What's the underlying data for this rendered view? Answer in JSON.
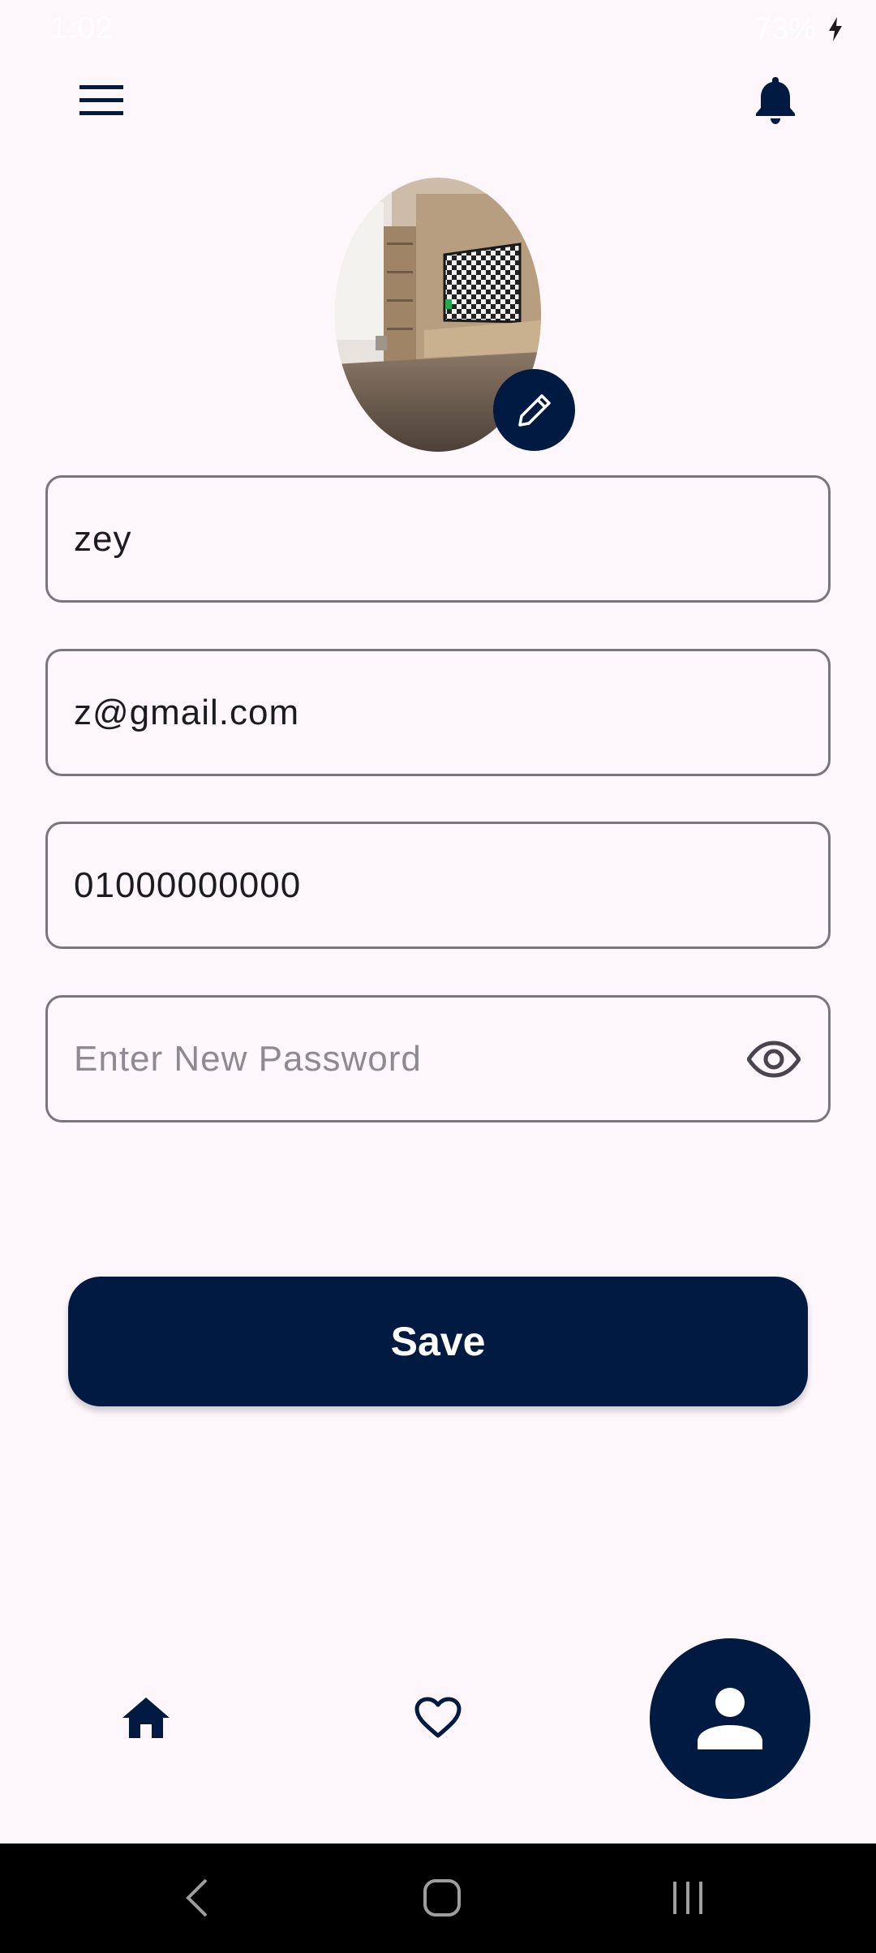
{
  "status_bar": {
    "time": "1:02",
    "battery": "73%"
  },
  "profile_form": {
    "name_value": "zey",
    "email_value": "z@gmail.com",
    "phone_value": "01000000000",
    "password_placeholder": "Enter New Password"
  },
  "actions": {
    "save_label": "Save"
  },
  "icons": {
    "menu": "hamburger-menu-icon",
    "notifications": "bell-icon",
    "edit": "pencil-icon",
    "visibility": "eye-icon",
    "home": "home-icon",
    "favorites": "heart-icon",
    "profile": "person-icon"
  },
  "colors": {
    "primary": "#011a41",
    "background": "#fdf7fc",
    "outline": "#79767d"
  }
}
